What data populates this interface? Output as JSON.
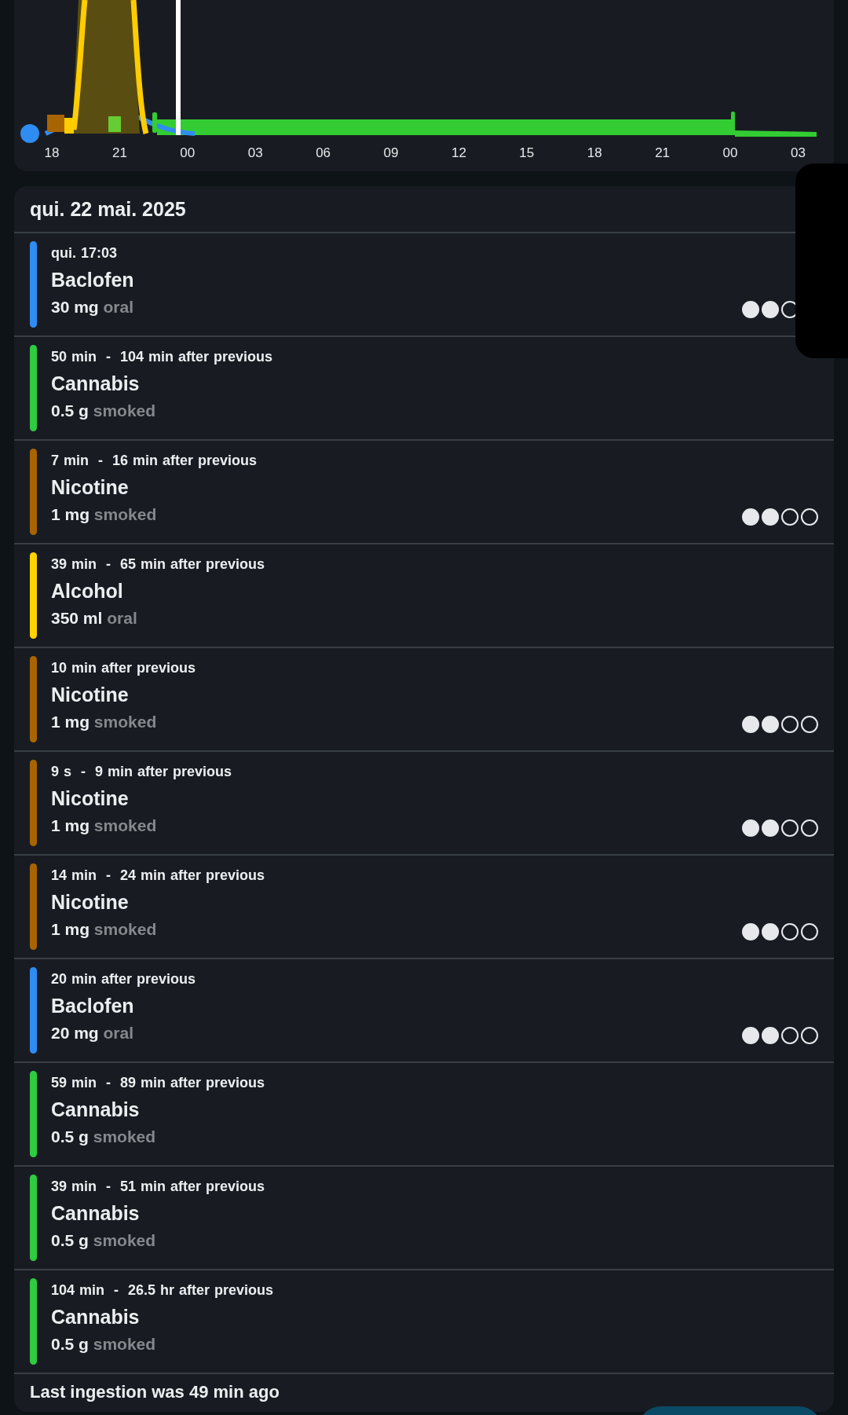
{
  "chart": {
    "axis_labels": [
      "18",
      "21",
      "00",
      "03",
      "06",
      "09",
      "12",
      "15",
      "18",
      "21",
      "00",
      "03"
    ]
  },
  "day": {
    "title": "qui. 22 mai. 2025"
  },
  "ingestions": [
    {
      "time": "qui. 17:03",
      "substance": "Baclofen",
      "dose": "30 mg",
      "route": "oral",
      "color": "#2f8cf2",
      "stars": 2
    },
    {
      "time": "50 min  -  104 min after previous",
      "substance": "Cannabis",
      "dose": "0.5 g",
      "route": "smoked",
      "color": "#2ecc40"
    },
    {
      "time": "7 min  -  16 min after previous",
      "substance": "Nicotine",
      "dose": "1 mg",
      "route": "smoked",
      "color": "#a86400",
      "stars": 2
    },
    {
      "time": "39 min  -  65 min after previous",
      "substance": "Alcohol",
      "dose": "350 ml",
      "route": "oral",
      "color": "#ffd400"
    },
    {
      "time": "10 min after previous",
      "substance": "Nicotine",
      "dose": "1 mg",
      "route": "smoked",
      "color": "#a86400",
      "stars": 2
    },
    {
      "time": "9 s  -  9 min after previous",
      "substance": "Nicotine",
      "dose": "1 mg",
      "route": "smoked",
      "color": "#a86400",
      "stars": 2
    },
    {
      "time": "14 min  -  24 min after previous",
      "substance": "Nicotine",
      "dose": "1 mg",
      "route": "smoked",
      "color": "#a86400",
      "stars": 2
    },
    {
      "time": "20 min after previous",
      "substance": "Baclofen",
      "dose": "20 mg",
      "route": "oral",
      "color": "#2f8cf2",
      "stars": 2
    },
    {
      "time": "59 min  -  89 min after previous",
      "substance": "Cannabis",
      "dose": "0.5 g",
      "route": "smoked",
      "color": "#2ecc40"
    },
    {
      "time": "39 min  -  51 min after previous",
      "substance": "Cannabis",
      "dose": "0.5 g",
      "route": "smoked",
      "color": "#2ecc40"
    },
    {
      "time": "104 min  -  26.5 hr after previous",
      "substance": "Cannabis",
      "dose": "0.5 g",
      "route": "smoked",
      "color": "#2ecc40"
    }
  ],
  "footer": {
    "text": "Last ingestion was 49 min ago"
  }
}
